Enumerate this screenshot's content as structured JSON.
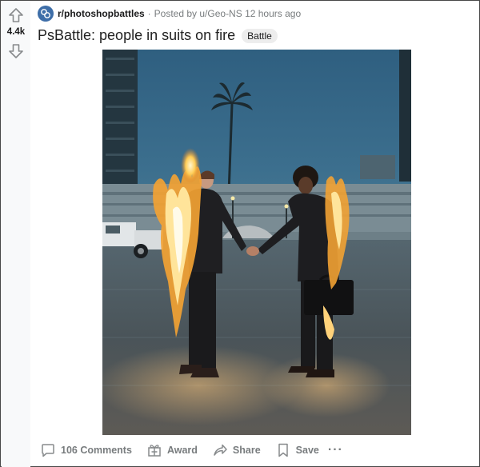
{
  "vote": {
    "score": "4.4k",
    "upvote_icon": "arrow-up-icon",
    "downvote_icon": "arrow-down-icon"
  },
  "post": {
    "subreddit": "r/photoshopbattles",
    "separator": "·",
    "posted_by": "Posted by u/Geo-NS 12 hours ago",
    "title": "PsBattle: people in suits on fire",
    "flair": "Battle"
  },
  "actions": {
    "comments": "106 Comments",
    "award": "Award",
    "share": "Share",
    "save": "Save",
    "more": "···"
  },
  "colors": {
    "avatar": "#3e6ea8",
    "sky": "#34607d",
    "meta_text": "#787c7e"
  }
}
